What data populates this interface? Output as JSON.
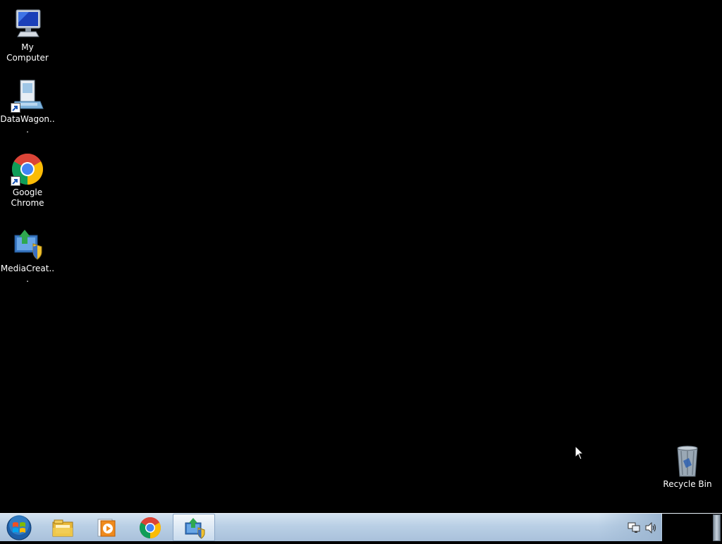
{
  "desktop": {
    "icons": [
      {
        "label": "My Computer",
        "icon": "computer-icon"
      },
      {
        "label": "DataWagon...",
        "icon": "datawagon-icon"
      },
      {
        "label": "Google Chrome",
        "icon": "chrome-icon"
      },
      {
        "label": "MediaCreat...",
        "icon": "media-creation-tool-icon"
      },
      {
        "label": "Recycle Bin",
        "icon": "recycle-bin-icon"
      }
    ]
  },
  "taskbar": {
    "start": {
      "icon": "windows-start-orb-icon"
    },
    "pinned": [
      {
        "icon": "file-explorer-icon"
      },
      {
        "icon": "media-player-icon"
      },
      {
        "icon": "chrome-icon"
      },
      {
        "icon": "media-creation-tool-icon",
        "active": true
      }
    ],
    "tray": [
      {
        "icon": "network-icon"
      },
      {
        "icon": "volume-icon"
      }
    ],
    "show_desktop": {
      "icon": "show-desktop-icon"
    }
  },
  "colors": {
    "desktop_background": "#000000",
    "taskbar": "#b9cfe5",
    "label_text": "#ffffff"
  }
}
